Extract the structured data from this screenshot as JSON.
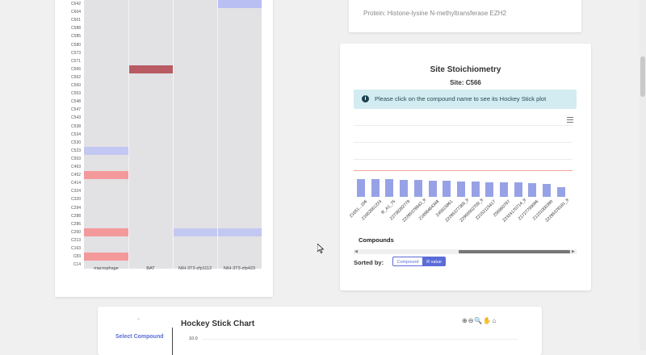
{
  "heatmap": {
    "rows": [
      "C642",
      "C604",
      "C601",
      "C588",
      "C585",
      "C580",
      "C573",
      "C571",
      "C566",
      "C562",
      "C560",
      "C553",
      "C548",
      "C547",
      "C543",
      "C538",
      "C534",
      "C530",
      "C523",
      "C503",
      "C463",
      "C452",
      "C414",
      "C324",
      "C320",
      "C294",
      "C288",
      "C286",
      "C260",
      "C213",
      "C163",
      "C83",
      "C14"
    ],
    "columns": [
      "macrophage",
      "BAT",
      "NIH-3T3-zfp1112",
      "NIH-3T3-zfp423"
    ],
    "cells": [
      {
        "row": "C642",
        "col": 3,
        "color": "#b9bff3"
      },
      {
        "row": "C566",
        "col": 1,
        "color": "#b85b63"
      },
      {
        "row": "C523",
        "col": 0,
        "color": "#c3c8f2"
      },
      {
        "row": "C452",
        "col": 0,
        "color": "#f4999b"
      },
      {
        "row": "C260",
        "col": 0,
        "color": "#f4999b"
      },
      {
        "row": "C260",
        "col": 2,
        "color": "#c3c8f2"
      },
      {
        "row": "C260",
        "col": 3,
        "color": "#c3c8f2"
      },
      {
        "row": "C83",
        "col": 0,
        "color": "#f4999b"
      }
    ]
  },
  "protein": {
    "text": "Protein: Histone-lysine N-methyltransferase EZH2"
  },
  "site": {
    "title": "Site Stoichiometry",
    "subtitle": "Site: C566",
    "info": "Please click on the compound name to see its Hockey Stick plot",
    "compounds_title": "Compounds",
    "sorted_by_label": "Sorted by:",
    "sort_compound_label": "Compound",
    "sort_rvalue_label": "R value",
    "colors": {
      "bar": "#97a2e6",
      "reference": "#f0a79a",
      "accent": "#5a6cd8",
      "info_bg": "#d2ecf1"
    }
  },
  "chart_data": {
    "type": "bar",
    "categories": [
      "Z1651...106",
      "Z1662661224",
      "R_A1_75",
      "Z2738282779",
      "Z2285378843_fr",
      "Z1898464348",
      "Z45915861",
      "Z2285377369_fr",
      "Z2955502709_fr",
      "Z2152115417",
      "Z56960797",
      "Z2324170714_fr",
      "Z1727799096",
      "Z1231000390",
      "Z2285378181_fr"
    ],
    "values": [
      1.0,
      0.99,
      0.98,
      0.96,
      0.94,
      0.92,
      0.9,
      0.88,
      0.86,
      0.84,
      0.82,
      0.8,
      0.78,
      0.75,
      0.55
    ],
    "title": "",
    "xlabel": "",
    "ylabel": ""
  },
  "hockey": {
    "title": "Hockey Stick Chart",
    "select_label": "Select Compound",
    "caret": "⌃",
    "ytick": "10.0",
    "tools": "⊕⊖🔍✋⌂"
  }
}
